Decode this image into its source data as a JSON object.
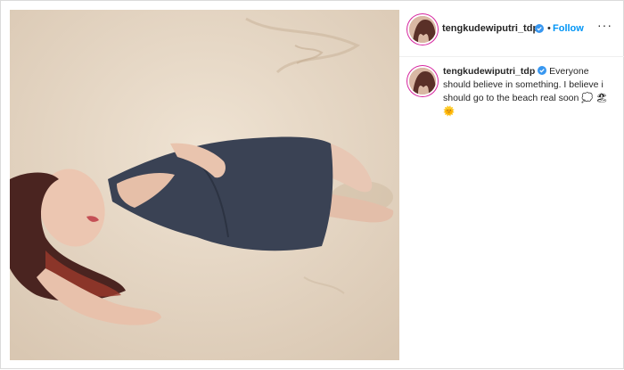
{
  "post": {
    "username": "tengkudewiputri_tdp",
    "separator": "•",
    "follow_label": "Follow",
    "more_label": "···",
    "caption": "Everyone should believe in something. I believe i should go to the beach real soon 💭 🏖 🌞"
  },
  "colors": {
    "link": "#0095f6",
    "verified": "#3897f0",
    "story_ring": "#d6249f"
  },
  "icons": [
    "verified-icon",
    "more-options-icon"
  ]
}
